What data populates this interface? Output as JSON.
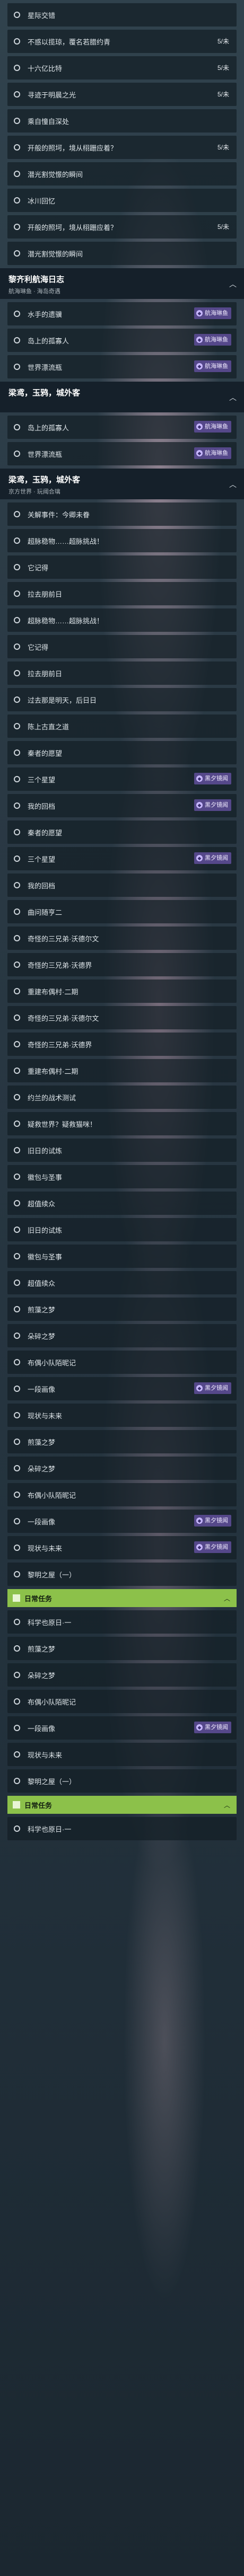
{
  "rows": [
    {
      "kind": "row",
      "label": "星际交错"
    },
    {
      "kind": "row",
      "label": "不惑以揽琼，覆名若腊约青",
      "badge": "5/未"
    },
    {
      "kind": "row",
      "label": "十六亿比特",
      "badge": "5/未"
    },
    {
      "kind": "row",
      "label": "寻迹于明晨之光",
      "badge": "5/未"
    },
    {
      "kind": "row",
      "label": "乘自憧自深处"
    },
    {
      "kind": "row",
      "label": "开般的照坷，境从栩跚应着？",
      "badge": "5/未"
    },
    {
      "kind": "row",
      "label": "潜光割觉憬的瞬间"
    },
    {
      "kind": "row",
      "label": "冰川回忆"
    },
    {
      "kind": "row",
      "label": "开般的照坷，境从栩跚应着？",
      "badge": "5/未"
    },
    {
      "kind": "row",
      "label": "潜光割觉憬的瞬间"
    },
    {
      "kind": "header",
      "title": "黎齐利航海日志",
      "subtitle": "航海琳鱼 · 海岛奇遇"
    },
    {
      "kind": "row",
      "label": "水手的遗骥",
      "tag": "航海琳鱼"
    },
    {
      "kind": "row",
      "label": "岛上的孤寡人",
      "tag": "航海琳鱼"
    },
    {
      "kind": "row",
      "label": "世界漂流瓶",
      "tag": "航海琳鱼"
    },
    {
      "kind": "header",
      "title": "梁鸢，玉鸦，城外客",
      "subtitle": ""
    },
    {
      "kind": "row",
      "label": "岛上的孤寡人",
      "tag": "航海琳鱼"
    },
    {
      "kind": "row",
      "label": "世界漂流瓶",
      "tag": "航海琳鱼"
    },
    {
      "kind": "header",
      "title": "梁鸢，玉鸦，城外客",
      "subtitle": "京方世界 · 玩阈合璃"
    },
    {
      "kind": "row",
      "label": "关解事件：今卿未眷"
    },
    {
      "kind": "row",
      "label": "超脉稳物……超脉挑战！"
    },
    {
      "kind": "row",
      "label": "它记得"
    },
    {
      "kind": "row",
      "label": "拉去朋前日"
    },
    {
      "kind": "row",
      "label": "超脉稳物……超脉挑战！"
    },
    {
      "kind": "row",
      "label": "它记得"
    },
    {
      "kind": "row",
      "label": "拉去朋前日"
    },
    {
      "kind": "row",
      "label": "过去那是明天，后日日"
    },
    {
      "kind": "row",
      "label": "陈上古直之道"
    },
    {
      "kind": "row",
      "label": "秦者的愿望"
    },
    {
      "kind": "row",
      "label": "三个星望",
      "tag": "黑夕镜闻"
    },
    {
      "kind": "row",
      "label": "我的回档",
      "tag": "黑夕镜闻"
    },
    {
      "kind": "row",
      "label": "秦者的愿望"
    },
    {
      "kind": "row",
      "label": "三个星望",
      "tag": "黑夕镜闻"
    },
    {
      "kind": "row",
      "label": "我的回档"
    },
    {
      "kind": "row",
      "label": "曲问随亨二"
    },
    {
      "kind": "row",
      "label": "奇怪的三兄弟·沃德尔文"
    },
    {
      "kind": "row",
      "label": "奇怪的三兄弟·沃德界"
    },
    {
      "kind": "row",
      "label": "重建布偶村·二期"
    },
    {
      "kind": "row",
      "label": "奇怪的三兄弟·沃德尔文"
    },
    {
      "kind": "row",
      "label": "奇怪的三兄弟·沃德界"
    },
    {
      "kind": "row",
      "label": "重建布偶村·二期"
    },
    {
      "kind": "row",
      "label": "约兰的战术测试"
    },
    {
      "kind": "row",
      "label": "疑救世界？疑救猫咪！"
    },
    {
      "kind": "row",
      "label": "旧日的试炼"
    },
    {
      "kind": "row",
      "label": "徽包与圣事"
    },
    {
      "kind": "row",
      "label": "超值续众"
    },
    {
      "kind": "row",
      "label": "旧日的试炼"
    },
    {
      "kind": "row",
      "label": "徽包与圣事"
    },
    {
      "kind": "row",
      "label": "超值续众"
    },
    {
      "kind": "row",
      "label": "煎藻之梦"
    },
    {
      "kind": "row",
      "label": "朵碎之梦"
    },
    {
      "kind": "row",
      "label": "布偶小队陌昵记"
    },
    {
      "kind": "row",
      "label": "一段画像",
      "tag": "黑夕镜闻"
    },
    {
      "kind": "row",
      "label": "现状与未来"
    },
    {
      "kind": "row",
      "label": "煎藻之梦"
    },
    {
      "kind": "row",
      "label": "朵碎之梦"
    },
    {
      "kind": "row",
      "label": "布偶小队陌昵记"
    },
    {
      "kind": "row",
      "label": "一段画像",
      "tag": "黑夕镜闻"
    },
    {
      "kind": "row",
      "label": "现状与未来",
      "tag": "黑夕镜闻"
    },
    {
      "kind": "row",
      "label": "黎明之屋（一）"
    },
    {
      "kind": "group",
      "label": "日常任务"
    },
    {
      "kind": "row",
      "label": "科学也原日·一"
    },
    {
      "kind": "row",
      "label": "煎藻之梦"
    },
    {
      "kind": "row",
      "label": "朵碎之梦"
    },
    {
      "kind": "row",
      "label": "布偶小队陌昵记"
    },
    {
      "kind": "row",
      "label": "一段画像",
      "tag": "黑夕镜闻"
    },
    {
      "kind": "row",
      "label": "现状与未来"
    },
    {
      "kind": "row",
      "label": "黎明之屋（一）"
    },
    {
      "kind": "group",
      "label": "日常任务"
    },
    {
      "kind": "row",
      "label": "科学也原日·一"
    }
  ],
  "icons": {
    "row_state": "circle-outline-icon",
    "tag": "mission-tag-icon",
    "collapse": "chevron-up-icon",
    "group": "task-icon"
  }
}
